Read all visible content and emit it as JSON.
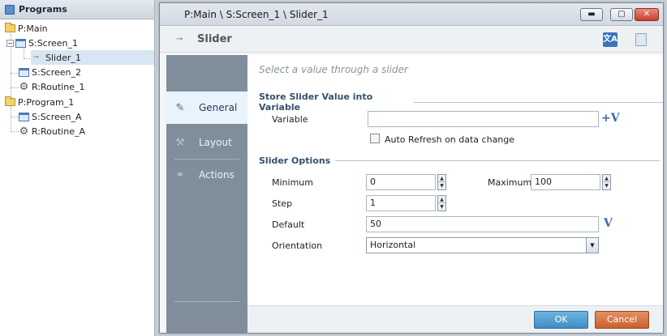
{
  "tree": {
    "header": "Programs",
    "items": [
      {
        "label": "P:Main"
      },
      {
        "label": "S:Screen_1"
      },
      {
        "label": "Slider_1"
      },
      {
        "label": "S:Screen_2"
      },
      {
        "label": "R:Routine_1"
      },
      {
        "label": "P:Program_1"
      },
      {
        "label": "S:Screen_A"
      },
      {
        "label": "R:Routine_A"
      }
    ]
  },
  "dialog": {
    "title": "P:Main \\ S:Screen_1 \\ Slider_1",
    "object_name": "Slider",
    "window_buttons": {
      "minimize": "▬",
      "maximize": "▢",
      "close": "✕"
    },
    "translate_icon": "文A"
  },
  "sidebar": {
    "items": [
      {
        "label": "General",
        "icon": "pencil-icon"
      },
      {
        "label": "Layout",
        "icon": "wrench-icon"
      },
      {
        "label": "Actions",
        "icon": "chain-icon"
      }
    ]
  },
  "content": {
    "hint": "Select a value through a slider",
    "store_section": "Store Slider Value into Variable",
    "variable_label": "Variable",
    "variable_value": "",
    "variable_button": "+V",
    "auto_refresh_label": "Auto Refresh on data change",
    "auto_refresh_checked": false,
    "options_section": "Slider Options",
    "minimum_label": "Minimum",
    "minimum_value": "0",
    "maximum_label": "Maximum",
    "maximum_value": "100",
    "step_label": "Step",
    "step_value": "1",
    "default_label": "Default",
    "default_value": "50",
    "default_button": "V",
    "orientation_label": "Orientation",
    "orientation_value": "Horizontal"
  },
  "footer": {
    "ok": "OK",
    "cancel": "Cancel"
  }
}
